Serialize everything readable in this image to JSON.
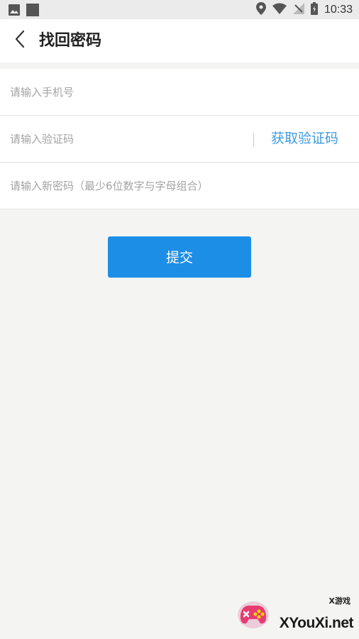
{
  "status_bar": {
    "time": "10:33",
    "icons": [
      "image-icon",
      "square-icon",
      "location-icon",
      "wifi-icon",
      "no-signal-icon",
      "battery-icon"
    ]
  },
  "header": {
    "title": "找回密码",
    "back_icon": "chevron-left-icon"
  },
  "form": {
    "phone": {
      "placeholder": "请输入手机号",
      "value": ""
    },
    "code": {
      "placeholder": "请输入验证码",
      "value": ""
    },
    "get_code_label": "获取验证码",
    "password": {
      "placeholder": "请输入新密码（最少6位数字与字母组合）",
      "value": ""
    }
  },
  "submit_label": "提交",
  "watermark": {
    "small": "X游戏",
    "text": "XYouXi.net"
  },
  "colors": {
    "accent": "#1d8ee6",
    "link": "#3e9be2",
    "background": "#f4f5f3"
  }
}
